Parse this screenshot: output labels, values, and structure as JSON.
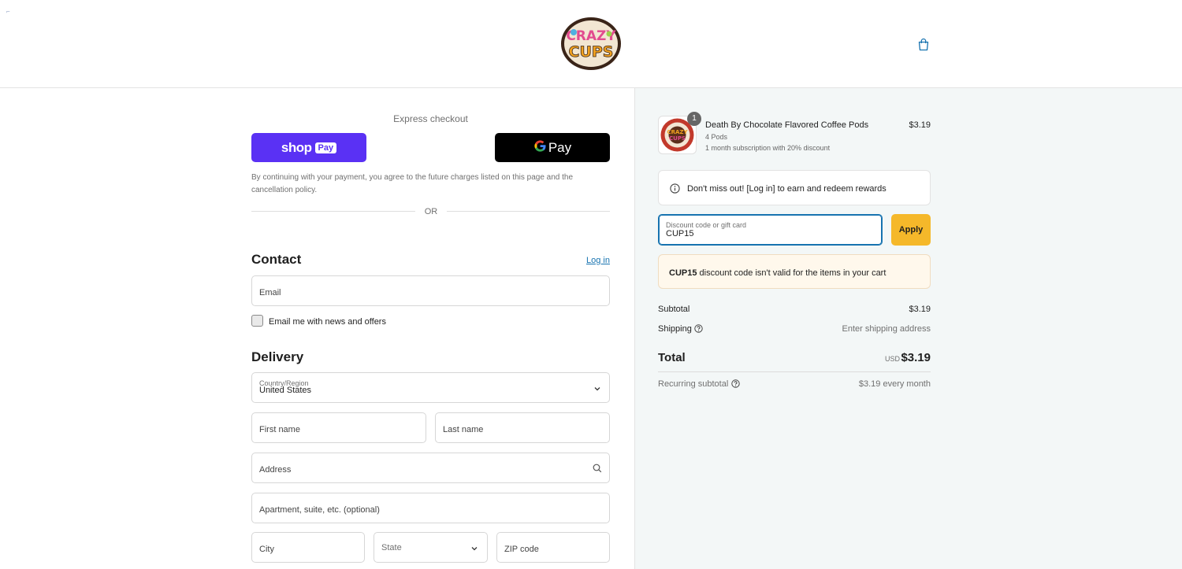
{
  "header": {
    "corner_mark": "⌐",
    "logo_text": "CRAZY CUPS",
    "cart_icon": "shopping-bag-icon"
  },
  "express": {
    "title": "Express checkout",
    "shoppay_word": "shop",
    "shoppay_pill": "Pay",
    "gpay_g": "G",
    "gpay_word": "Pay",
    "terms": "By continuing with your payment, you agree to the future charges listed on this page and the cancellation policy.",
    "or": "OR"
  },
  "contact": {
    "title": "Contact",
    "login": "Log in",
    "email_placeholder": "Email",
    "newsletter_label": "Email me with news and offers"
  },
  "delivery": {
    "title": "Delivery",
    "country_label": "Country/Region",
    "country_value": "United States",
    "first_name": "First name",
    "last_name": "Last name",
    "address": "Address",
    "apartment": "Apartment, suite, etc. (optional)",
    "city": "City",
    "state": "State",
    "zip": "ZIP code"
  },
  "order": {
    "item": {
      "quantity": "1",
      "name": "Death By Chocolate Flavored Coffee Pods",
      "variant": "4 Pods",
      "subscription": "1 month subscription with 20% discount",
      "price": "$3.19"
    },
    "rewards_text": "Don't miss out! [Log in] to earn and redeem rewards",
    "discount_label": "Discount code or gift card",
    "discount_value": "CUP15",
    "apply": "Apply",
    "warning_code": "CUP15",
    "warning_rest": " discount code isn't valid for the items in your cart",
    "subtotal_label": "Subtotal",
    "subtotal_value": "$3.19",
    "shipping_label": "Shipping",
    "shipping_value": "Enter shipping address",
    "total_label": "Total",
    "total_currency": "USD",
    "total_value": "$3.19",
    "recurring_label": "Recurring subtotal",
    "recurring_value": "$3.19 every month"
  },
  "colors": {
    "shop_pay": "#5a31f4",
    "apply_button": "#f5b82a",
    "link": "#1773b0",
    "summary_bg": "#f3f7f7"
  }
}
